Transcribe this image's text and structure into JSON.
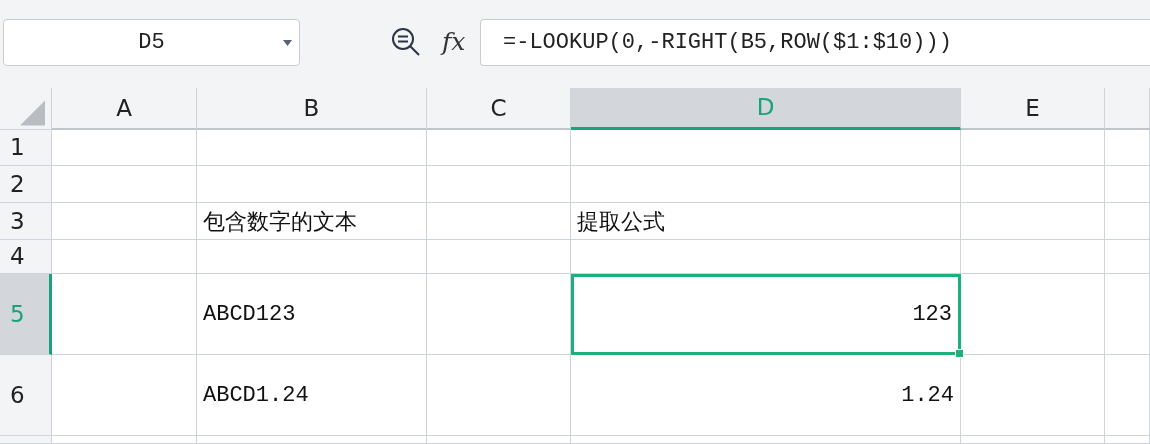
{
  "name_box": {
    "value": "D5"
  },
  "formula_bar": {
    "function_label": "fx",
    "value": "=-LOOKUP(0,-RIGHT(B5,ROW($1:$10)))"
  },
  "columns": [
    {
      "label": "A",
      "selected": false
    },
    {
      "label": "B",
      "selected": false
    },
    {
      "label": "C",
      "selected": false
    },
    {
      "label": "D",
      "selected": true
    },
    {
      "label": "E",
      "selected": false
    }
  ],
  "rows": [
    {
      "label": "1",
      "selected": false,
      "cells": [
        null,
        null,
        null,
        null,
        null
      ]
    },
    {
      "label": "2",
      "selected": false,
      "cells": [
        null,
        null,
        null,
        null,
        null
      ]
    },
    {
      "label": "3",
      "selected": false,
      "cells": [
        null,
        {
          "kind": "text",
          "text": "包含数字的文本",
          "selected": false
        },
        null,
        {
          "kind": "text",
          "text": "提取公式",
          "selected": false
        },
        null
      ]
    },
    {
      "label": "4",
      "selected": false,
      "cells": [
        null,
        null,
        null,
        null,
        null
      ]
    },
    {
      "label": "5",
      "selected": true,
      "cells": [
        null,
        {
          "kind": "text",
          "text": "ABCD123",
          "selected": false
        },
        null,
        {
          "kind": "number",
          "text": "123",
          "selected": true
        },
        null
      ]
    },
    {
      "label": "6",
      "selected": false,
      "cells": [
        null,
        {
          "kind": "text",
          "text": "ABCD1.24",
          "selected": false
        },
        null,
        {
          "kind": "number",
          "text": "1.24",
          "selected": false
        },
        null
      ]
    }
  ]
}
